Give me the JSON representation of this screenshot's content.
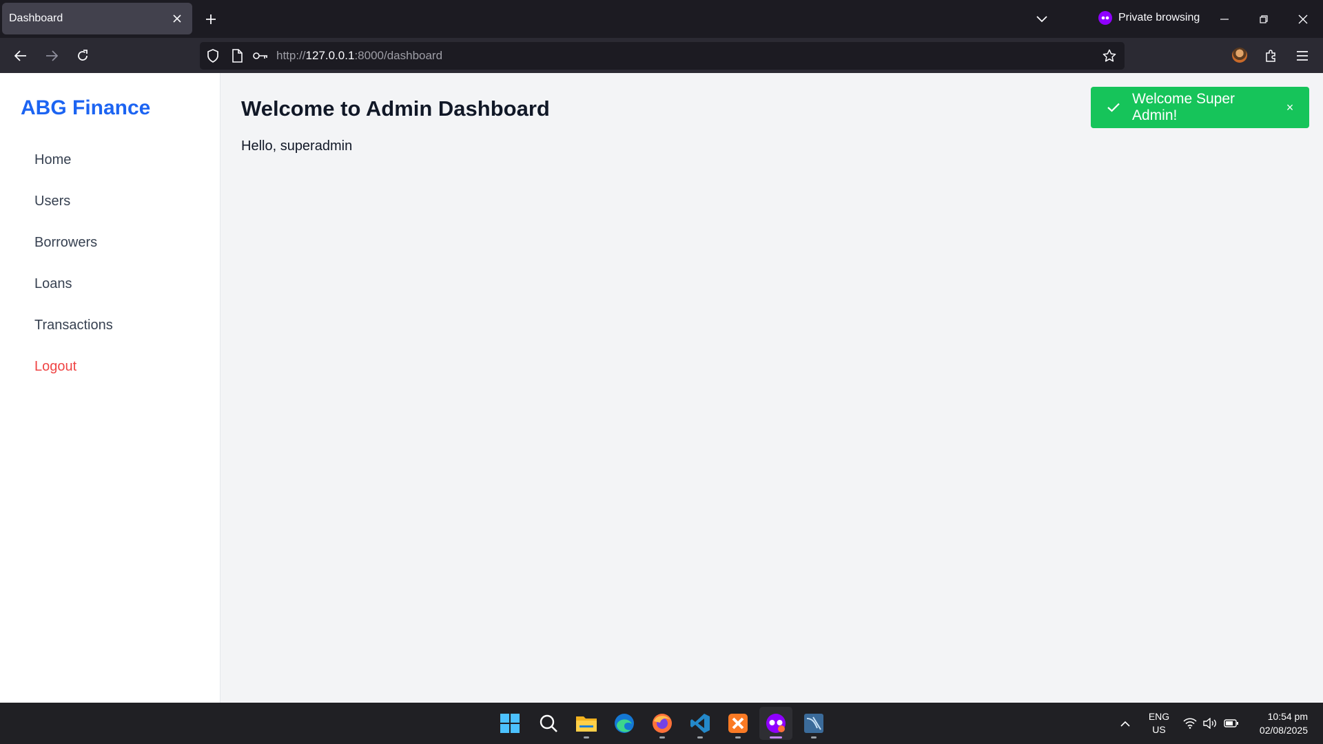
{
  "browser": {
    "tab_title": "Dashboard",
    "private_label": "Private browsing",
    "url_prefix": "http://",
    "url_host": "127.0.0.1",
    "url_rest": ":8000/dashboard"
  },
  "app": {
    "brand": "ABG Finance",
    "nav": [
      {
        "label": "Home"
      },
      {
        "label": "Users"
      },
      {
        "label": "Borrowers"
      },
      {
        "label": "Loans"
      },
      {
        "label": "Transactions"
      },
      {
        "label": "Logout"
      }
    ],
    "heading": "Welcome to Admin Dashboard",
    "greeting": "Hello, superadmin",
    "toast": {
      "message": "Welcome Super Admin!",
      "close": "×"
    },
    "colors": {
      "brand": "#1c64f2",
      "logout": "#ef4444",
      "toast": "#16c45a"
    }
  },
  "taskbar": {
    "apps": [
      "windows-start",
      "search",
      "file-explorer",
      "edge",
      "firefox",
      "vscode",
      "xampp",
      "firefox-private",
      "mysql-workbench"
    ],
    "lang_line1": "ENG",
    "lang_line2": "US",
    "time": "10:54 pm",
    "date": "02/08/2025"
  }
}
